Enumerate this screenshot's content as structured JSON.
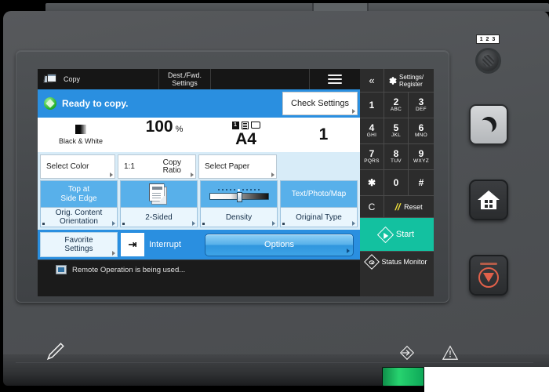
{
  "device": {
    "name": "multifunction-printer-control-panel",
    "hardware_keys": [
      {
        "name": "counter-check-key",
        "label": "1 2 3",
        "icon": "counter-icon"
      },
      {
        "name": "energy-saver-key",
        "label": "",
        "icon": "moon-icon"
      },
      {
        "name": "home-key",
        "label": "",
        "icon": "home-icon"
      },
      {
        "name": "stop-key",
        "label": "",
        "icon": "stop-icon"
      }
    ],
    "front_icons": [
      {
        "name": "usb-port-icon",
        "glyph": "usb"
      },
      {
        "name": "error-indicator-icon",
        "glyph": "warning"
      },
      {
        "name": "pen-holder-icon",
        "glyph": "pen"
      }
    ],
    "colors": {
      "accent_blue": "#2a8fe0",
      "tile_blue": "#58b0ea",
      "start_green": "#13c1a0",
      "shell_gray": "#4e5154",
      "screen_black": "#1b1b1b",
      "status_green": "#27b32c",
      "stop_red": "#e0604a",
      "indicator_green": "#27d36f"
    }
  },
  "appbar": {
    "copy_tab": "Copy",
    "copy_icon": "copy-stack-icon",
    "dest_fwd_tab": "Dest./Fwd.\nSettings",
    "dest_fwd_line1": "Dest./Fwd.",
    "dest_fwd_line2": "Settings",
    "blank_tab": "",
    "menu_icon": "hamburger-menu-icon"
  },
  "status": {
    "message": "Ready to copy.",
    "icon": "ready-status-icon",
    "check_settings_label": "Check Settings"
  },
  "info_strip": {
    "color_mode": {
      "label": "Black & White",
      "icon": "black-white-gradient-icon"
    },
    "copy_ratio": {
      "value": "100",
      "unit": "%"
    },
    "paper": {
      "value": "A4",
      "icons": [
        "count-1-icon",
        "document-icon",
        "sheet-icon"
      ]
    },
    "copies": {
      "value": "1"
    }
  },
  "option_buttons": [
    {
      "name": "select-color",
      "label": "Select Color"
    },
    {
      "name": "copy-ratio",
      "label_left": "1:1",
      "label_line1": "Copy",
      "label_line2": "Ratio"
    },
    {
      "name": "select-paper",
      "label": "Select Paper"
    }
  ],
  "tiles": [
    {
      "name": "orig-content-orientation",
      "top_line1": "Top at",
      "top_line2": "Side Edge",
      "bottom_line1": "Orig. Content",
      "bottom_line2": "Orientation",
      "icon": ""
    },
    {
      "name": "two-sided",
      "top_line1": "",
      "top_line2": "",
      "bottom_line1": "2-Sided",
      "bottom_line2": "",
      "icon": "two-sided-sheet-icon"
    },
    {
      "name": "density",
      "top_line1": "",
      "top_line2": "",
      "bottom_line1": "Density",
      "bottom_line2": "",
      "icon": "density-slider-icon"
    },
    {
      "name": "original-type",
      "top_line1": "Text/Photo/Map",
      "top_line2": "",
      "bottom_line1": "Original Type",
      "bottom_line2": "",
      "icon": ""
    }
  ],
  "action_row": {
    "favorite_line1": "Favorite",
    "favorite_line2": "Settings",
    "interrupt_label": "Interrupt",
    "interrupt_icon": "interrupt-icon",
    "interrupt_glyph": "⇥",
    "options_label": "Options"
  },
  "message_bar": {
    "text": "Remote Operation is being used...",
    "icon": "remote-operation-icon"
  },
  "keypad": {
    "back_glyph": "«",
    "settings_line1": "Settings/",
    "settings_line2": "Register",
    "settings_icon": "gear-icon",
    "keys": [
      {
        "num": "1",
        "sub": ""
      },
      {
        "num": "2",
        "sub": "ABC"
      },
      {
        "num": "3",
        "sub": "DEF"
      },
      {
        "num": "4",
        "sub": "GHI"
      },
      {
        "num": "5",
        "sub": "JKL"
      },
      {
        "num": "6",
        "sub": "MNO"
      },
      {
        "num": "7",
        "sub": "PQRS"
      },
      {
        "num": "8",
        "sub": "TUV"
      },
      {
        "num": "9",
        "sub": "WXYZ"
      },
      {
        "num": "✱",
        "sub": ""
      },
      {
        "num": "0",
        "sub": ""
      },
      {
        "num": "#",
        "sub": ""
      }
    ],
    "clear_label": "C",
    "reset_label": "Reset",
    "reset_icon": "reset-icon",
    "start_label": "Start",
    "start_icon": "start-diamond-icon",
    "status_monitor_label": "Status Monitor",
    "status_monitor_icon": "status-monitor-icon"
  }
}
